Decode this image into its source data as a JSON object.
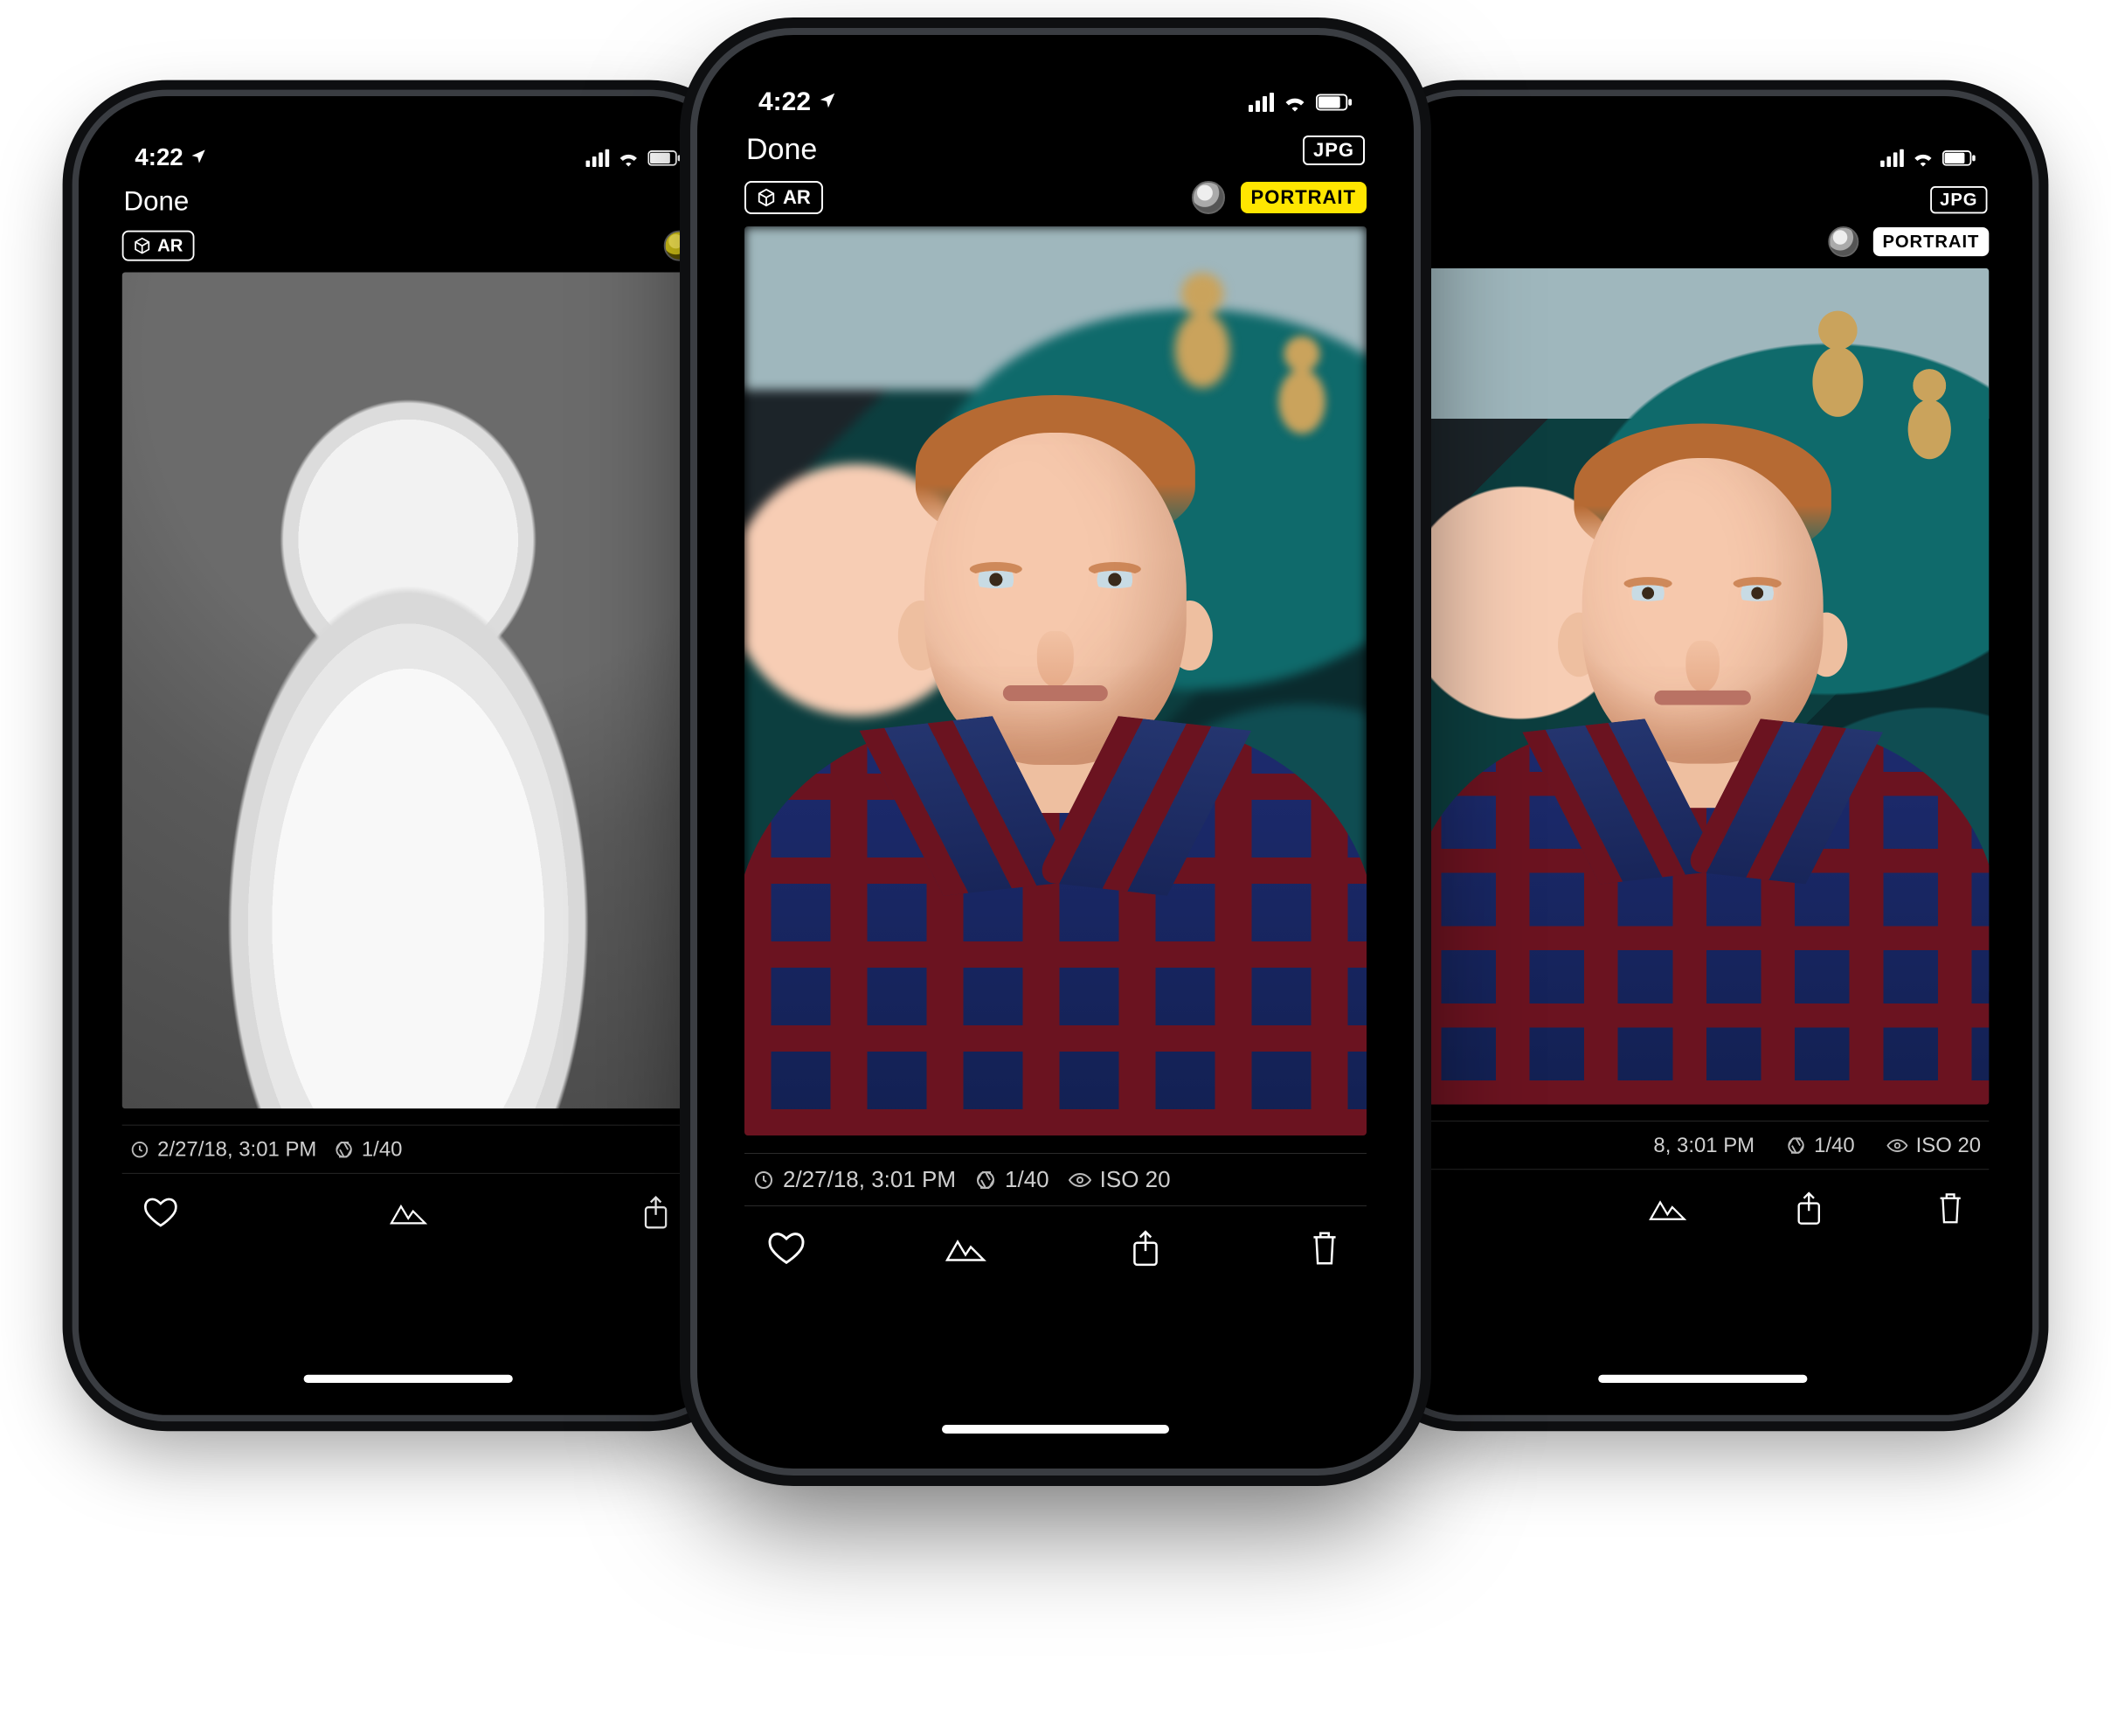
{
  "status": {
    "time": "4:22",
    "loc_icon": "location-arrow-icon"
  },
  "nav": {
    "done": "Done",
    "format_badge": "JPG"
  },
  "tools": {
    "ar_label": "AR",
    "portrait_label": "PORTRAIT"
  },
  "meta": {
    "date": "2/27/18, 3:01 PM",
    "shutter": "1/40",
    "iso": "ISO 20",
    "date_partial_right": "8, 3:01 PM"
  },
  "colors": {
    "accent_yellow": "#ffe600"
  }
}
